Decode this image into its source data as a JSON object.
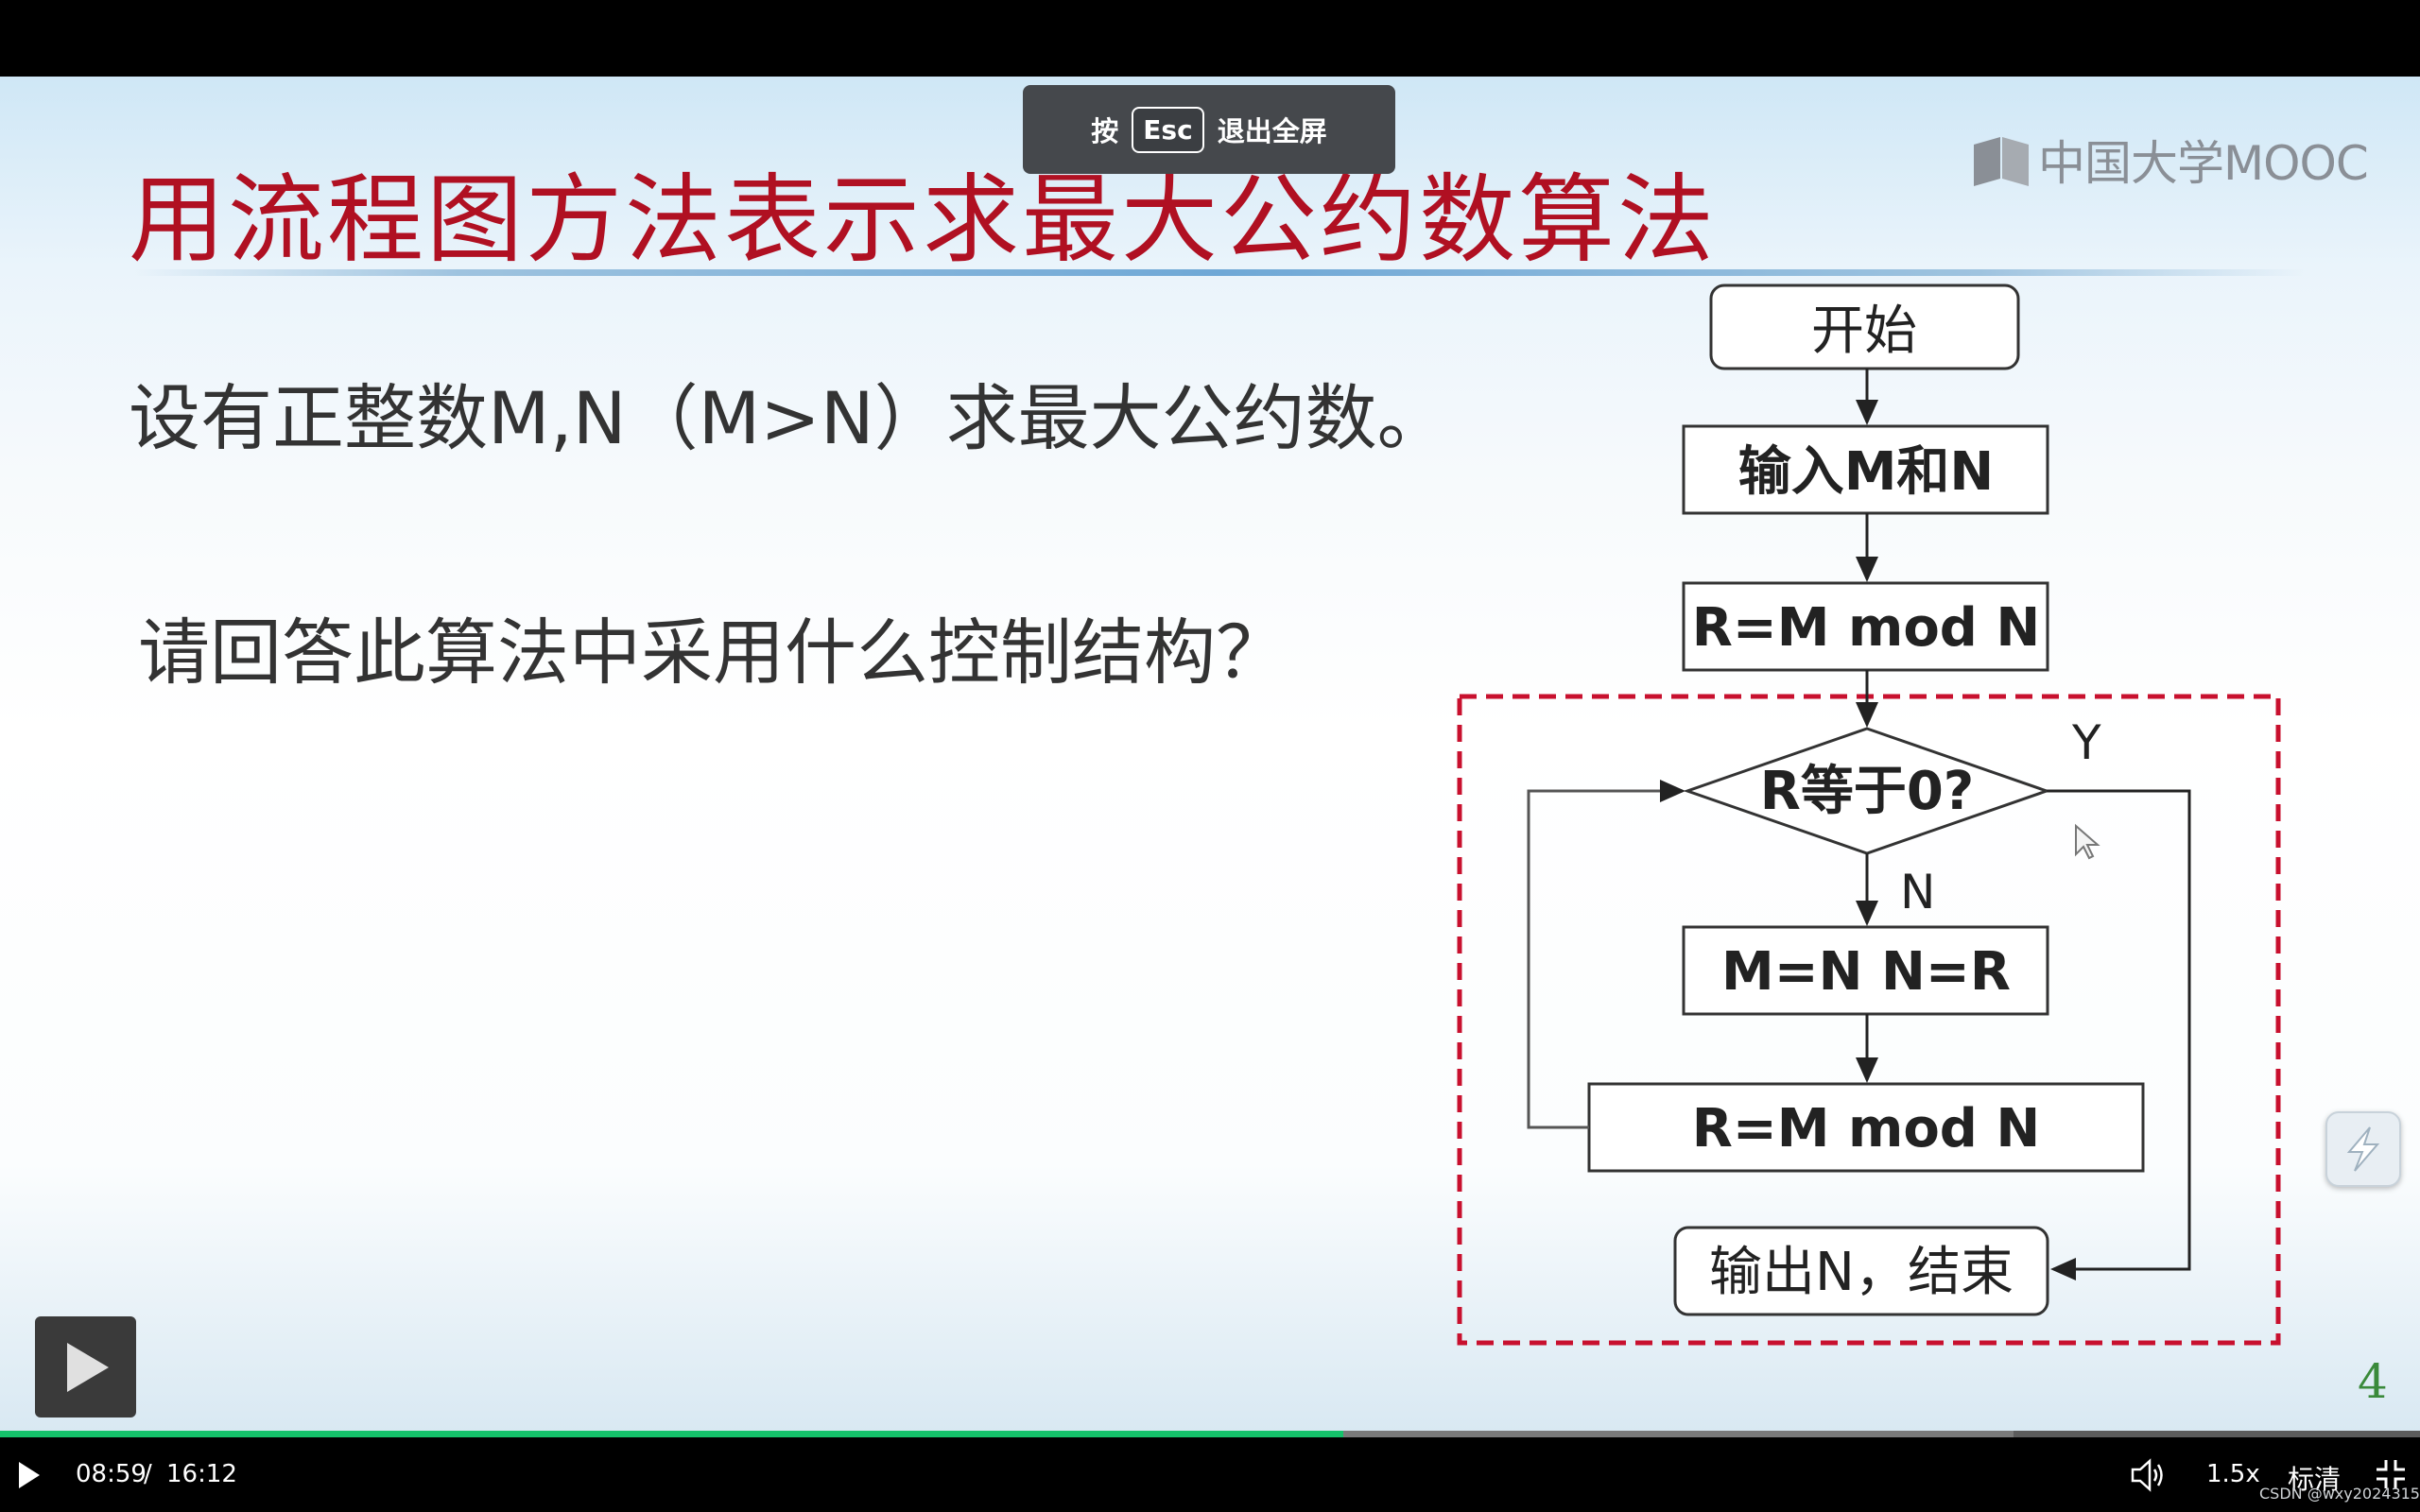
{
  "toast": {
    "prefix": "按",
    "key": "Esc",
    "suffix": "退出全屏"
  },
  "slide": {
    "title": "用流程图方法表示求最大公约数算法",
    "logo_text": "中国大学MOOC",
    "line1": "设有正整数M,N（M>N）求最大公约数。",
    "line2": "请回答此算法中采用什么控制结构？",
    "page_number": "4"
  },
  "flowchart": {
    "start": "开始",
    "input": "输入M和N",
    "step1": "R=M mod N",
    "decision": "R等于0?",
    "yes_label": "Y",
    "no_label": "N",
    "assign": "M=N N=R",
    "step2": "R=M mod N",
    "output": "输出N，结束",
    "highlight_color": "#c8102e"
  },
  "player": {
    "time_current": "08:59",
    "time_separator": "/",
    "time_total": "16:12",
    "speed": "1.5x",
    "quality": "标清",
    "progress_played": 0.555,
    "progress_buffered": 0.832,
    "accent_color": "#15c26b"
  },
  "watermark": "CSDN @wxy2024315"
}
